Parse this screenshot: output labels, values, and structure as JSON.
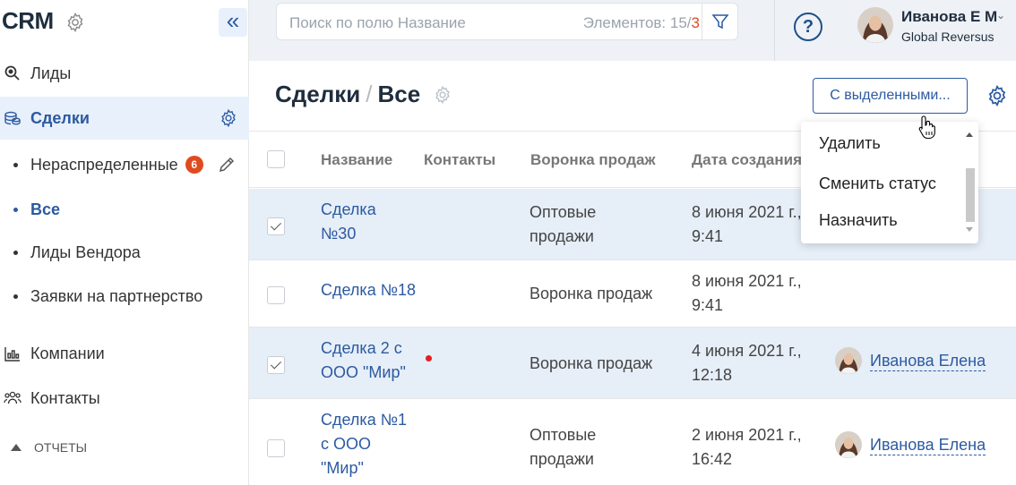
{
  "sidebar": {
    "logo": "CRM",
    "collapse_icon": "«",
    "nav": [
      {
        "label": "Лиды",
        "icon": "search-leads-icon"
      },
      {
        "label": "Сделки",
        "icon": "coins-icon",
        "active": true
      },
      {
        "label": "Компании",
        "icon": "chart-icon"
      },
      {
        "label": "Контакты",
        "icon": "people-icon"
      }
    ],
    "sub": [
      {
        "label": "Нераспределенные",
        "badge": "6"
      },
      {
        "label": "Все",
        "active": true
      },
      {
        "label": "Лиды Вендора"
      },
      {
        "label": "Заявки на партнерство"
      }
    ],
    "reports": "ОТЧЕТЫ"
  },
  "topbar": {
    "search_placeholder": "Поиск по полю Название",
    "count_label": "Элементов: 15",
    "count_sep": "/",
    "count_selected": "3",
    "help": "?",
    "user_name": "Иванова Е М",
    "user_org": "Global Reversus"
  },
  "main": {
    "title": "Сделки",
    "title_sep": "/",
    "subtitle": "Все",
    "selected_button": "С выделенными...",
    "columns": [
      "Название",
      "Контакты",
      "Воронка продаж",
      "Дата создания"
    ],
    "rows": [
      {
        "name": [
          "Сделка",
          "№30"
        ],
        "funnel": [
          "Оптовые",
          "продажи"
        ],
        "date": [
          "8 июня 2021 г.,",
          "9:41"
        ],
        "checked": true,
        "assignee": ""
      },
      {
        "name": [
          "Сделка №18"
        ],
        "funnel": [
          "Воронка продаж"
        ],
        "date": [
          "8 июня 2021 г.,",
          "9:41"
        ],
        "checked": false,
        "assignee": ""
      },
      {
        "name": [
          "Сделка 2 с",
          "ООО \"Мир\""
        ],
        "funnel": [
          "Воронка продаж"
        ],
        "date": [
          "4 июня 2021 г.,",
          "12:18"
        ],
        "checked": true,
        "assignee": "Иванова Елена"
      },
      {
        "name": [
          "Сделка №1",
          "с ООО",
          "\"Мир\""
        ],
        "funnel": [
          "Оптовые",
          "продажи"
        ],
        "date": [
          "2 июня 2021 г.,",
          "16:42"
        ],
        "checked": false,
        "assignee": "Иванова Елена"
      }
    ]
  },
  "dropdown": {
    "items": [
      "Удалить",
      "Сменить статус",
      "Назначить"
    ]
  },
  "colors": {
    "accent": "#2c5aa0",
    "badge": "#e04a1f",
    "selected_row": "#e6eef8",
    "topbar": "#eef1f6"
  }
}
